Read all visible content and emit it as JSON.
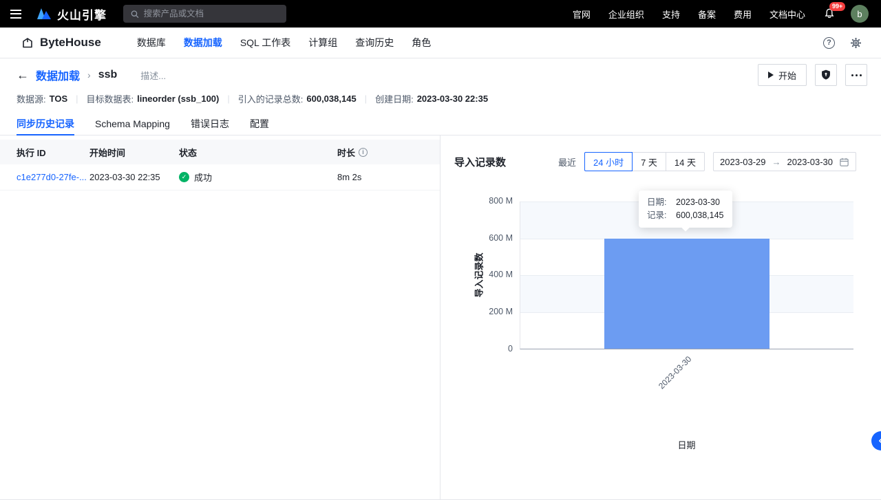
{
  "colors": {
    "accent": "#1664ff",
    "bar": "#6c9cf2",
    "success": "#00b365",
    "badge": "#f53f3f"
  },
  "topnav": {
    "brand": "火山引擎",
    "search_placeholder": "搜索产品或文档",
    "links": [
      "官网",
      "企业组织",
      "支持",
      "备案",
      "费用",
      "文档中心"
    ],
    "notification_badge": "99+",
    "avatar_initial": "b"
  },
  "appnav": {
    "brand": "ByteHouse",
    "items": [
      "数据库",
      "数据加载",
      "SQL 工作表",
      "计算组",
      "查询历史",
      "角色"
    ]
  },
  "header": {
    "back": "←",
    "breadcrumb_parent": "数据加载",
    "breadcrumb_sep": "›",
    "title": "ssb",
    "description": "描述...",
    "start_label": "开始"
  },
  "meta": [
    {
      "label": "数据源:",
      "value": "TOS"
    },
    {
      "label": "目标数据表:",
      "value": "lineorder (ssb_100)"
    },
    {
      "label": "引入的记录总数:",
      "value": "600,038,145"
    },
    {
      "label": "创建日期:",
      "value": "2023-03-30 22:35"
    }
  ],
  "tabs": [
    "同步历史记录",
    "Schema Mapping",
    "错误日志",
    "配置"
  ],
  "table": {
    "columns": [
      "执行 ID",
      "开始时间",
      "状态",
      "时长"
    ],
    "rows": [
      {
        "execution_id": "c1e277d0-27fe-...",
        "start_time": "2023-03-30 22:35",
        "status": "成功",
        "duration": "8m 2s"
      }
    ]
  },
  "chart_panel": {
    "title": "导入记录数",
    "recent_label": "最近",
    "ranges": [
      "24 小时",
      "7 天",
      "14 天"
    ],
    "active_range": "24 小时",
    "date_from": "2023-03-29",
    "date_arrow": "→",
    "date_to": "2023-03-30",
    "tooltip": {
      "date_label": "日期:",
      "date_value": "2023-03-30",
      "records_label": "记录:",
      "records_value": "600,038,145"
    }
  },
  "chart_data": {
    "type": "bar",
    "title": "导入记录数",
    "categories": [
      "2023-03-30"
    ],
    "values": [
      600038145
    ],
    "xlabel": "日期",
    "ylabel": "导入记录数",
    "ylim": [
      0,
      800000000
    ],
    "yticks": [
      "800 M",
      "600 M",
      "400 M",
      "200 M",
      "0"
    ],
    "bar_color": "#6c9cf2",
    "legend": false,
    "grid": true
  }
}
